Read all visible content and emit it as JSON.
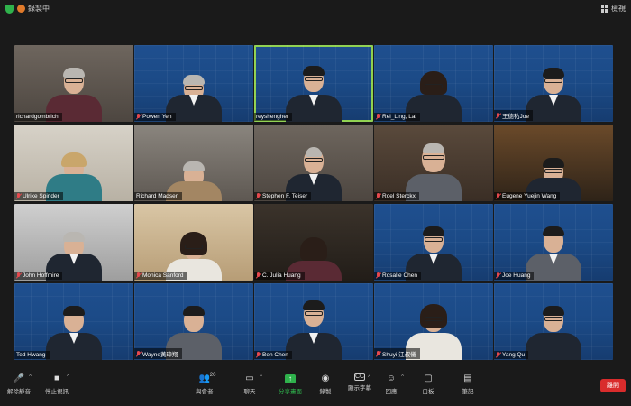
{
  "topbar": {
    "recording_label": "錄製中",
    "view_label": "檢視"
  },
  "participants": [
    {
      "name": "richardgombrich",
      "muted": false
    },
    {
      "name": "Powen Yen",
      "muted": true
    },
    {
      "name": "reyshengher",
      "muted": false
    },
    {
      "name": "Rei_Ling, Lai",
      "muted": true
    },
    {
      "name": "王德祐Joe",
      "muted": true
    },
    {
      "name": "Ulrike Spinder",
      "muted": true
    },
    {
      "name": "Richard Madsen",
      "muted": false
    },
    {
      "name": "Stephen F. Teiser",
      "muted": true
    },
    {
      "name": "Roel Sterckx",
      "muted": true
    },
    {
      "name": "Eugene Yuejin Wang",
      "muted": true
    },
    {
      "name": "John Hoffmire",
      "muted": true
    },
    {
      "name": "Monica Sanford",
      "muted": true
    },
    {
      "name": "C. Julia Huang",
      "muted": true
    },
    {
      "name": "Rosalie Chen",
      "muted": true
    },
    {
      "name": "Joe Huang",
      "muted": true
    },
    {
      "name": "Ted Hwang",
      "muted": false
    },
    {
      "name": "Wayne黃瑋翔",
      "muted": true
    },
    {
      "name": "Ben Chen",
      "muted": true
    },
    {
      "name": "Shuyi 江叔儀",
      "muted": true
    },
    {
      "name": "Yang Qu",
      "muted": true
    }
  ],
  "toolbar": {
    "unmute_label": "解除靜音",
    "stop_video_label": "停止視訊",
    "participants_label": "與會者",
    "participants_count": "20",
    "chat_label": "聊天",
    "share_label": "分享畫面",
    "record_label": "錄製",
    "captions_label": "顯示字幕",
    "reactions_label": "回應",
    "whiteboard_label": "白板",
    "notes_label": "筆記",
    "leave_label": "離開"
  },
  "colors": {
    "speaking_border": "#8fd14f",
    "share_accent": "#2fb24c",
    "leave_button": "#d92c2c",
    "muted_icon": "#e5484d"
  }
}
